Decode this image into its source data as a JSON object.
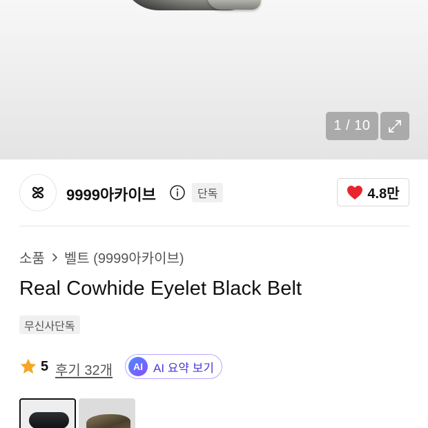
{
  "gallery": {
    "counter": "1 / 10"
  },
  "brand": {
    "name": "9999아카이브",
    "badge": "단독",
    "likes": "4.8만",
    "like_color": "#e8242f"
  },
  "breadcrumb": {
    "category": "소품",
    "subcategory": "벨트 (9999아카이브)"
  },
  "product": {
    "title": "Real Cowhide Eyelet Black Belt",
    "tag": "무신사단독"
  },
  "rating": {
    "score": "5",
    "reviews": "후기 32개",
    "star_color": "#f5a623"
  },
  "ai_summary": {
    "icon_text": "AI",
    "label": "AI 요약 보기"
  },
  "icons": {
    "expand": "expand-icon",
    "info": "info-icon",
    "heart": "heart-icon",
    "star": "star-icon",
    "chevron": "chevron-right-icon",
    "brand_logo": "brand-logo-icon"
  }
}
